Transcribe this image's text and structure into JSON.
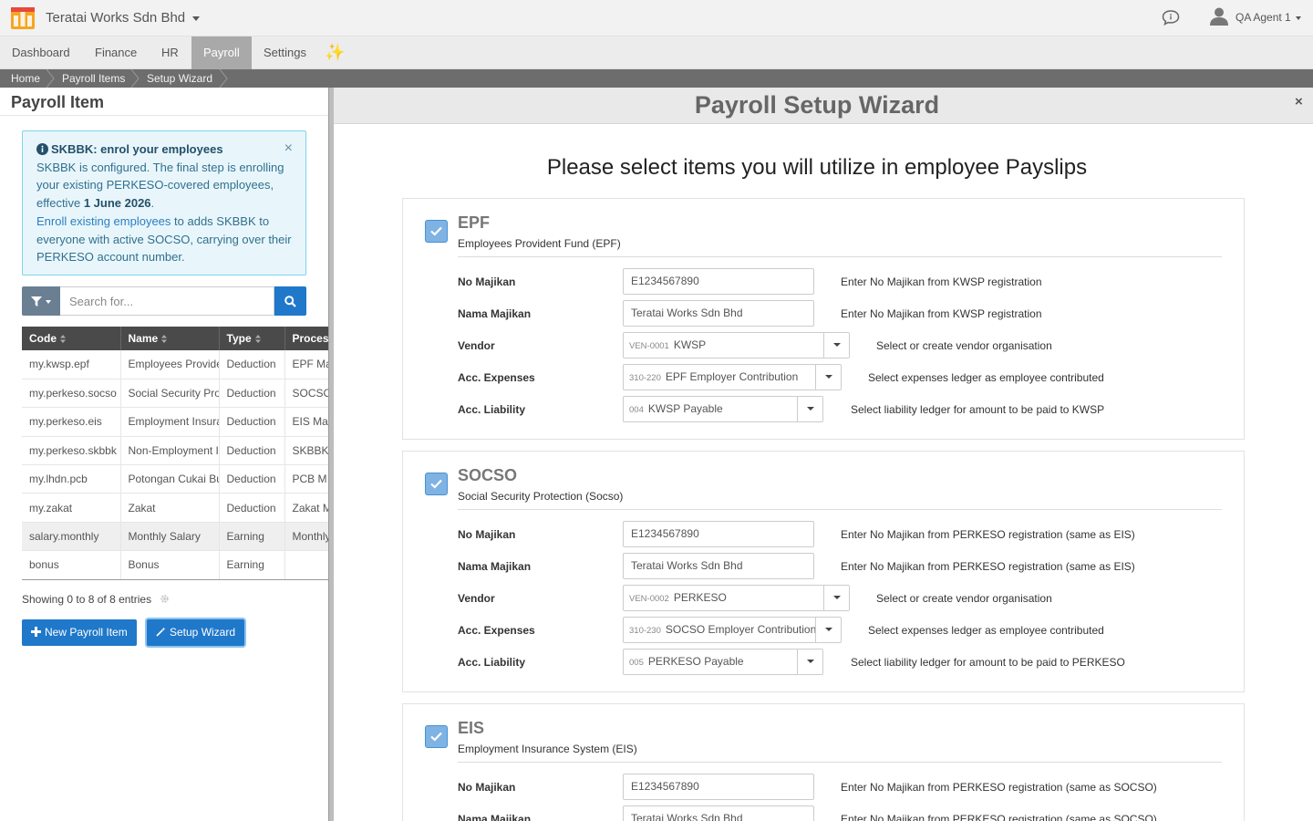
{
  "app": {
    "company": "Teratai Works Sdn Bhd",
    "user": "QA Agent 1"
  },
  "nav": {
    "items": [
      "Dashboard",
      "Finance",
      "HR",
      "Payroll",
      "Settings"
    ],
    "active": "Payroll"
  },
  "breadcrumb": [
    "Home",
    "Payroll Items",
    "Setup Wizard"
  ],
  "left": {
    "title": "Payroll Item",
    "alert": {
      "heading": "SKBBK: enrol your employees",
      "line1": "SKBBK is configured. The final step is enrolling your existing PERKESO-covered employees, effective",
      "date": "1 June 2026",
      "period": ".",
      "link": "Enroll existing employees",
      "line2": "to adds SKBBK to everyone with active SOCSO, carrying over their PERKESO account number.",
      "close": "×"
    },
    "search_placeholder": "Search for...",
    "columns": [
      "Code",
      "Name",
      "Type",
      "Proces"
    ],
    "rows": [
      [
        "my.kwsp.epf",
        "Employees Provident Fund",
        "Deduction",
        "EPF Ma"
      ],
      [
        "my.perkeso.socso",
        "Social Security Protection",
        "Deduction",
        "SOCSO"
      ],
      [
        "my.perkeso.eis",
        "Employment Insurance",
        "Deduction",
        "EIS Ma"
      ],
      [
        "my.perkeso.skbbk",
        "Non-Employment Injury",
        "Deduction",
        "SKBBK"
      ],
      [
        "my.lhdn.pcb",
        "Potongan Cukai Bulanan",
        "Deduction",
        "PCB M"
      ],
      [
        "my.zakat",
        "Zakat",
        "Deduction",
        "Zakat M"
      ],
      [
        "salary.monthly",
        "Monthly Salary",
        "Earning",
        "Monthly"
      ],
      [
        "bonus",
        "Bonus",
        "Earning",
        ""
      ]
    ],
    "showing": "Showing 0 to 8 of 8 entries",
    "new_button": "New Payroll Item",
    "wizard_button": "Setup Wizard"
  },
  "wizard": {
    "title": "Payroll Setup Wizard",
    "close": "×",
    "heading": "Please select items you will utilize in employee Payslips",
    "labels": {
      "no_majikan": "No Majikan",
      "nama_majikan": "Nama Majikan",
      "vendor": "Vendor",
      "acc_expenses": "Acc. Expenses",
      "acc_liability": "Acc. Liability"
    },
    "sections": [
      {
        "title": "EPF",
        "subtitle": "Employees Provident Fund (EPF)",
        "no_majikan": "E1234567890",
        "no_majikan_help": "Enter No Majikan from KWSP registration",
        "nama_majikan": "Teratai Works Sdn Bhd",
        "nama_majikan_help": "Enter No Majikan from KWSP registration",
        "vendor_code": "VEN-0001",
        "vendor": "KWSP",
        "vendor_help": "Select or create vendor organisation",
        "expenses_code": "310-220",
        "expenses": "EPF Employer Contribution",
        "expenses_help": "Select expenses ledger as employee contributed",
        "liability_code": "004",
        "liability": "KWSP Payable",
        "liability_help": "Select liability ledger for amount to be paid to KWSP"
      },
      {
        "title": "SOCSO",
        "subtitle": "Social Security Protection (Socso)",
        "no_majikan": "E1234567890",
        "no_majikan_help": "Enter No Majikan from PERKESO registration (same as EIS)",
        "nama_majikan": "Teratai Works Sdn Bhd",
        "nama_majikan_help": "Enter No Majikan from PERKESO registration (same as EIS)",
        "vendor_code": "VEN-0002",
        "vendor": "PERKESO",
        "vendor_help": "Select or create vendor organisation",
        "expenses_code": "310-230",
        "expenses": "SOCSO Employer Contribution",
        "expenses_help": "Select expenses ledger as employee contributed",
        "liability_code": "005",
        "liability": "PERKESO Payable",
        "liability_help": "Select liability ledger for amount to be paid to PERKESO"
      },
      {
        "title": "EIS",
        "subtitle": "Employment Insurance System (EIS)",
        "no_majikan": "E1234567890",
        "no_majikan_help": "Enter No Majikan from PERKESO registration (same as SOCSO)",
        "nama_majikan": "Teratai Works Sdn Bhd",
        "nama_majikan_help": "Enter No Majikan from PERKESO registration (same as SOCSO)"
      }
    ]
  }
}
